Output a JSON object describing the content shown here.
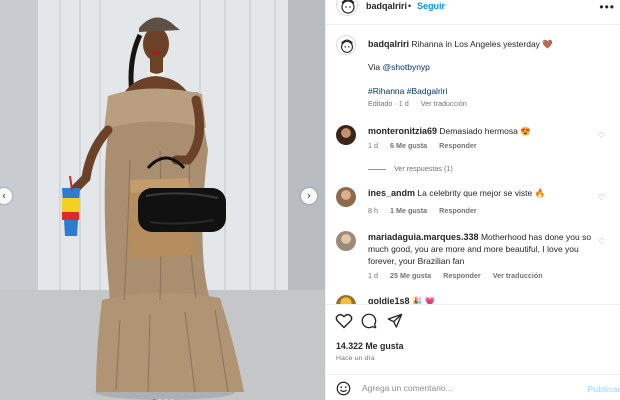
{
  "post": {
    "author": "badqalriri",
    "follow_label": "Seguir",
    "more_glyph": "•••",
    "caption": {
      "username": "badqalriri",
      "text": "Rihanna in Los Angeles yesterday",
      "emoji": "🤎",
      "via_label": "Via",
      "via_handle": "@shotbynyp",
      "hashtags": "#Rihanna #Badgalriri",
      "edited": "Editado · 1 d",
      "see_translation": "Ver traducción"
    },
    "comments": [
      {
        "username": "monteronitzia69",
        "text": "Demasiado hermosa 😍",
        "time": "1 d",
        "likes": "6 Me gusta",
        "reply": "Responder",
        "view_replies": "Ver respuestas (1)"
      },
      {
        "username": "ines_andm",
        "text": "La celebrity que mejor se viste 🔥",
        "time": "8 h",
        "likes": "1 Me gusta",
        "reply": "Responder"
      },
      {
        "username": "mariadaguia.marques.338",
        "text": "Motherhood has done you so much good, you are more and more beautiful, I love you forever, your Brazilian fan",
        "time": "1 d",
        "likes": "25 Me gusta",
        "reply": "Responder",
        "translate": "Ver traducción"
      },
      {
        "username": "goldie1s8",
        "text": "🎉 💗"
      }
    ],
    "likes_count": "14.322 Me gusta",
    "posted_ago": "Hace un día",
    "add_comment_placeholder": "Agrega un comentario...",
    "publish_label": "Publicar"
  },
  "carousel": {
    "total": 4,
    "active_index": 0
  },
  "icons": {
    "prev": "chevron-left-icon",
    "next": "chevron-right-icon",
    "like": "heart-icon",
    "comment": "comment-icon",
    "share": "share-icon",
    "emoji": "emoji-icon",
    "comment_like": "heart-outline-icon"
  },
  "colors": {
    "link": "#00376b",
    "accent": "#0095f6",
    "muted": "#737373",
    "dress": "#a98e70",
    "bag": "#111111"
  }
}
